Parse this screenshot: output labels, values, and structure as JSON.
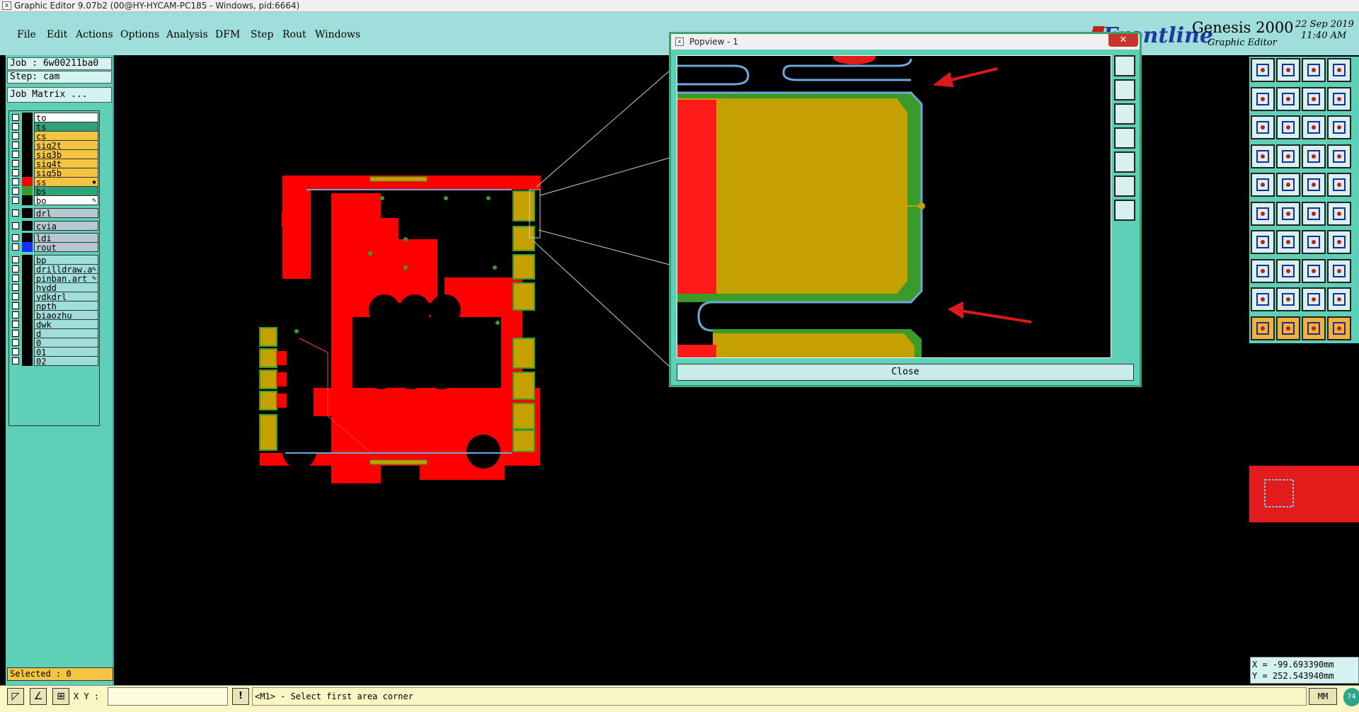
{
  "window": {
    "title": "Graphic Editor 9.07b2 (00@HY-HYCAM-PC185 - Windows, pid:6664)",
    "icon": "x-window-icon"
  },
  "menu": [
    "File",
    "Edit",
    "Actions",
    "Options",
    "Analysis",
    "DFM",
    "Step",
    "Rout",
    "Windows"
  ],
  "brand": {
    "logo": "Frontline",
    "product": "Genesis 2000",
    "subtitle": "Graphic Editor",
    "date": "22 Sep 2019",
    "time": "11:40 AM"
  },
  "left_panel": {
    "job": "Job : 6w00211ba0",
    "step": "Step: cam",
    "job_matrix_button": "Job Matrix ...",
    "layers": [
      {
        "name": "to",
        "swatch": "#000000",
        "bg": "#ffffff",
        "mark": ""
      },
      {
        "name": "ts",
        "swatch": "#000000",
        "bg": "#2ea37a",
        "mark": ""
      },
      {
        "name": "cs",
        "swatch": "#000000",
        "bg": "#f4c542",
        "mark": ""
      },
      {
        "name": "sig2t",
        "swatch": "#000000",
        "bg": "#f4c542",
        "mark": ""
      },
      {
        "name": "sig3b",
        "swatch": "#000000",
        "bg": "#f4c542",
        "mark": ""
      },
      {
        "name": "sig4t",
        "swatch": "#000000",
        "bg": "#f4c542",
        "mark": ""
      },
      {
        "name": "sig5b",
        "swatch": "#000000",
        "bg": "#f4c542",
        "mark": ""
      },
      {
        "name": "ss",
        "swatch": "#ff0000",
        "bg": "#f4c542",
        "mark": "▪"
      },
      {
        "name": "bs",
        "swatch": "#3a9a2a",
        "bg": "#2ea37a",
        "mark": ""
      },
      {
        "name": "bo",
        "swatch": "#000000",
        "bg": "#ffffff",
        "mark": "✎"
      },
      {
        "name": "drl",
        "swatch": "#000000",
        "bg": "#b8c8d2",
        "mark": ""
      },
      {
        "name": "cvia",
        "swatch": "#000000",
        "bg": "#b8c8d2",
        "mark": ""
      },
      {
        "name": "ldi",
        "swatch": "#000000",
        "bg": "#b8c8d2",
        "mark": ""
      },
      {
        "name": "rout",
        "swatch": "#1a2dff",
        "bg": "#b8c8d2",
        "mark": ""
      },
      {
        "name": "bp",
        "swatch": "#000000",
        "bg": "#9fdedb",
        "mark": ""
      },
      {
        "name": "drilldraw.a",
        "swatch": "#000000",
        "bg": "#9fdedb",
        "mark": "✎"
      },
      {
        "name": "pinban.art",
        "swatch": "#000000",
        "bg": "#9fdedb",
        "mark": "✎"
      },
      {
        "name": "hydd",
        "swatch": "#000000",
        "bg": "#9fdedb",
        "mark": ""
      },
      {
        "name": "ydkdrl",
        "swatch": "#000000",
        "bg": "#9fdedb",
        "mark": ""
      },
      {
        "name": "npth",
        "swatch": "#000000",
        "bg": "#9fdedb",
        "mark": ""
      },
      {
        "name": "biaozhu",
        "swatch": "#000000",
        "bg": "#9fdedb",
        "mark": ""
      },
      {
        "name": "dwk",
        "swatch": "#000000",
        "bg": "#9fdedb",
        "mark": ""
      },
      {
        "name": "d",
        "swatch": "#000000",
        "bg": "#9fdedb",
        "mark": ""
      },
      {
        "name": "0",
        "swatch": "#000000",
        "bg": "#9fdedb",
        "mark": ""
      },
      {
        "name": "01",
        "swatch": "#000000",
        "bg": "#9fdedb",
        "mark": ""
      },
      {
        "name": "02",
        "swatch": "#000000",
        "bg": "#9fdedb",
        "mark": ""
      }
    ],
    "selected": "Selected : 0"
  },
  "bottom": {
    "xy_label": "X Y :",
    "xy_value": "",
    "bang": "!",
    "status": "<M1> - Select first area corner",
    "units": "MM",
    "round_btn": "74"
  },
  "coords": {
    "x": "X = -99.693390mm",
    "y": "Y = 252.543940mm"
  },
  "popview": {
    "title": "Popview - 1",
    "close": "Close",
    "close_x": "✕"
  },
  "colors": {
    "copper_red": "#ff0000",
    "pad_gold": "#c4a000",
    "mask_green": "#3a9a2a",
    "trace_blue": "#6fa8d8",
    "panel_teal": "#5fd0b8",
    "arrow_red": "#d81a1a"
  }
}
